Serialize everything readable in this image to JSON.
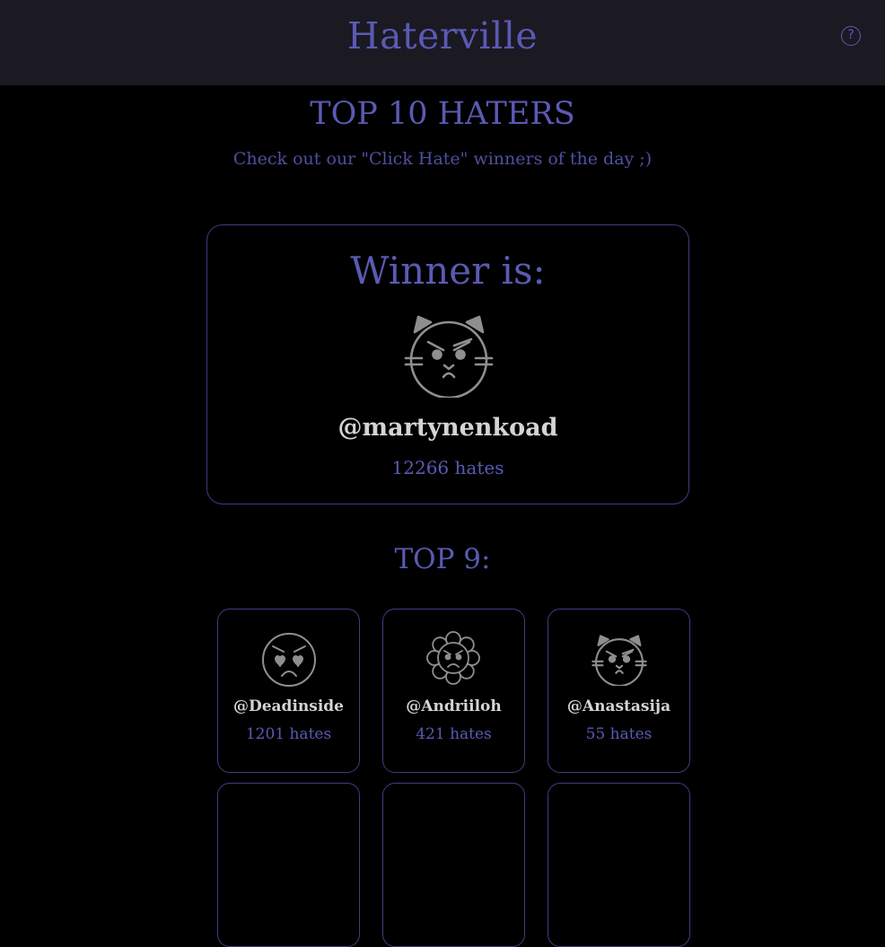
{
  "header": {
    "brand": "Haterville",
    "help_icon": "question-circle-icon",
    "help_symbol": "?"
  },
  "page": {
    "title": "TOP 10 HATERS",
    "subtitle": "Check out our \"Click Hate\" winners of the day ;)"
  },
  "winner": {
    "heading": "Winner is:",
    "avatar_icon": "angry-cat-icon",
    "username": "@martynenkoad",
    "hates": "12266 hates"
  },
  "top9": {
    "title": "TOP 9:",
    "entries": [
      {
        "avatar_icon": "angry-heart-eyes-face-icon",
        "username": "@Deadinside",
        "hates": "1201 hates"
      },
      {
        "avatar_icon": "angry-flower-icon",
        "username": "@Andriiloh",
        "hates": "421 hates"
      },
      {
        "avatar_icon": "angry-cat-icon",
        "username": "@Anastasija",
        "hates": "55 hates"
      }
    ]
  },
  "colors": {
    "background": "#000000",
    "header_bg": "#1b1922",
    "accent": "#5a5ab4",
    "username": "#d4d4d4",
    "card_border": "#3d3d82",
    "icon_stroke": "#8f8f8f"
  }
}
